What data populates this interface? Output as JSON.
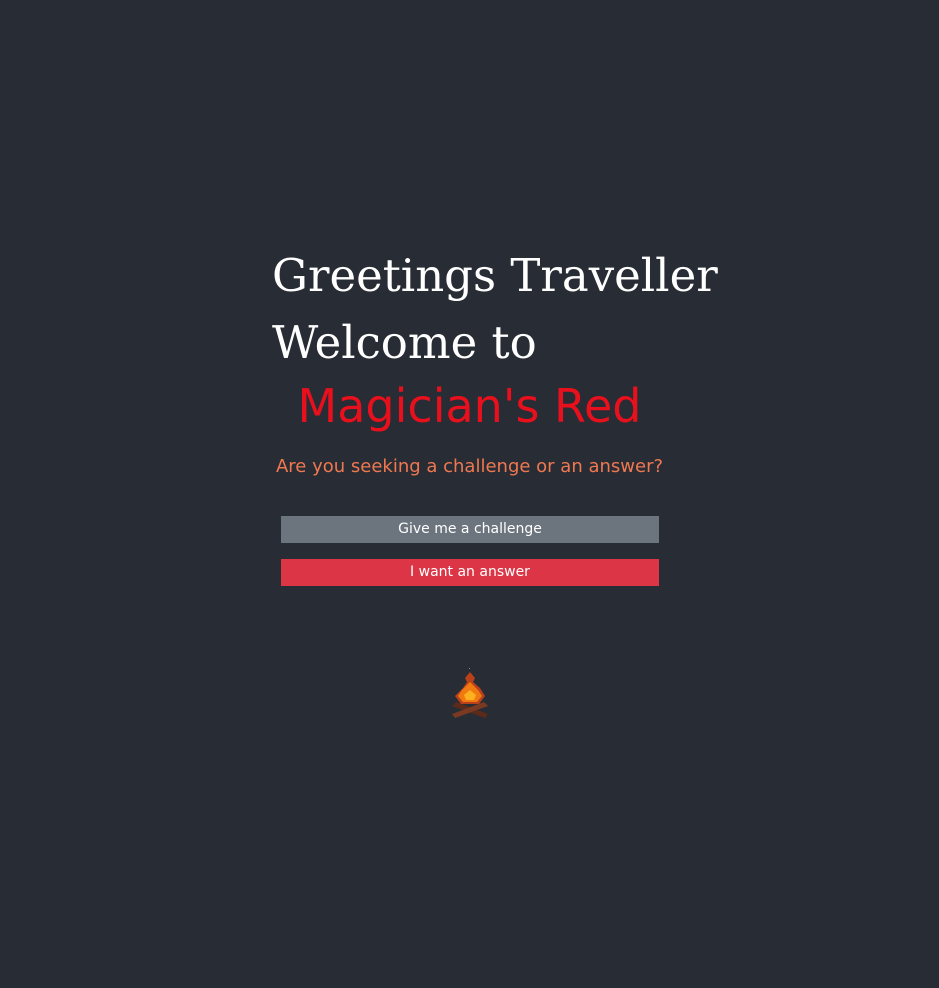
{
  "greeting": {
    "line1": "Greetings Traveller",
    "line2": "Welcome to"
  },
  "brand": {
    "name": "Magician's Red",
    "color": "#e8101c"
  },
  "prompt": {
    "question": "Are you seeking a challenge or an answer?",
    "color": "#f07850"
  },
  "actions": {
    "challenge_label": "Give me a challenge",
    "challenge_color": "#6c757d",
    "answer_label": "I want an answer",
    "answer_color": "#dc3545"
  },
  "decoration": {
    "icon": "campfire-icon"
  },
  "theme": {
    "background": "#282c34",
    "text": "#ffffff"
  }
}
